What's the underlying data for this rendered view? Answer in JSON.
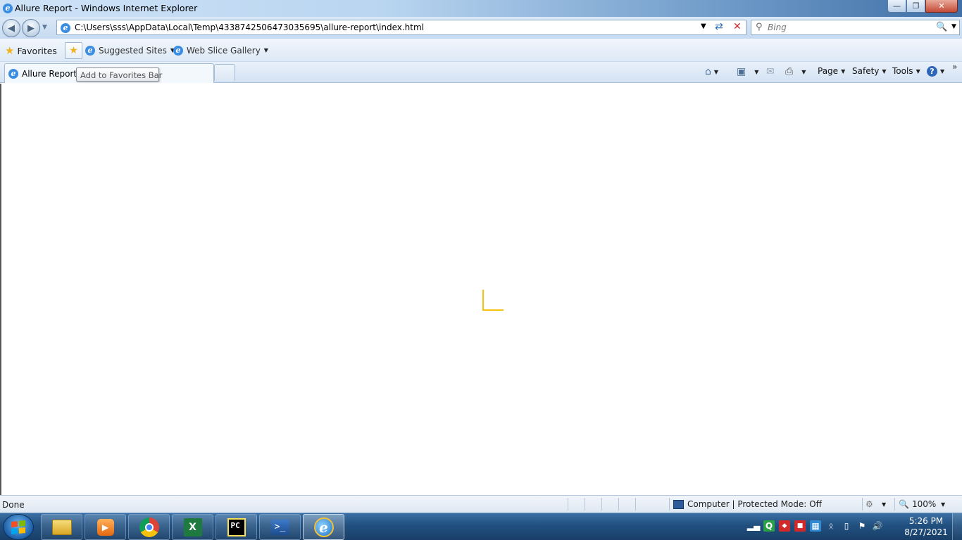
{
  "window": {
    "title": "Allure Report - Windows Internet Explorer"
  },
  "address": {
    "url": "C:\\Users\\sss\\AppData\\Local\\Temp\\4338742506473035695\\allure-report\\index.html"
  },
  "search": {
    "placeholder": "Bing"
  },
  "favorites_bar": {
    "favorites_label": "Favorites",
    "suggested_sites_label": "Suggested Sites",
    "web_slice_gallery_label": "Web Slice Gallery"
  },
  "tabs": [
    {
      "label": "Allure Report"
    }
  ],
  "tooltip": {
    "text": "Add to Favorites Bar"
  },
  "command_bar": {
    "page_label": "Page",
    "safety_label": "Safety",
    "tools_label": "Tools"
  },
  "status_bar": {
    "status_text": "Done",
    "zone_text": "Computer | Protected Mode: Off",
    "zoom": "100%"
  },
  "taskbar": {
    "time": "5:26 PM",
    "date": "8/27/2021",
    "apps": [
      "file-explorer",
      "media-player",
      "chrome",
      "excel",
      "pycharm",
      "powershell",
      "internet-explorer"
    ]
  },
  "colors": {
    "loader_accent": "#f7c20d",
    "taskbar": "#21507f"
  }
}
